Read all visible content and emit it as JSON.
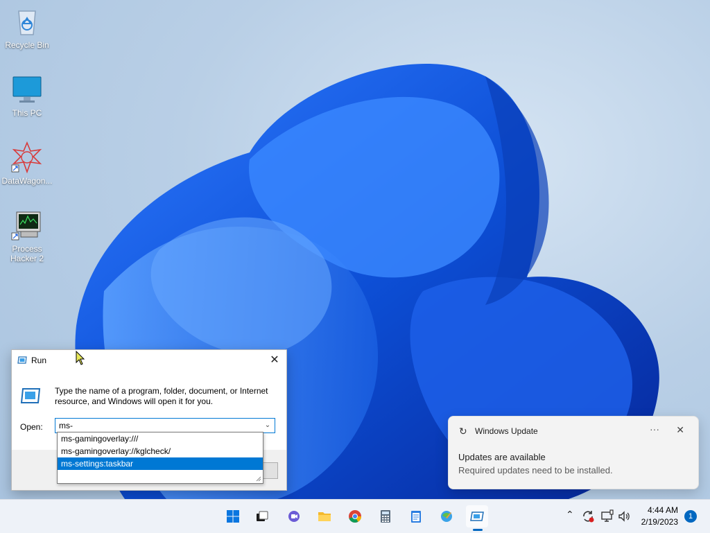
{
  "desktop": {
    "icons": [
      {
        "label": "Recycle Bin"
      },
      {
        "label": "This PC"
      },
      {
        "label": "DataWagon..."
      },
      {
        "label": "Process Hacker 2"
      }
    ]
  },
  "run_dialog": {
    "title": "Run",
    "close": "✕",
    "description": "Type the name of a program, folder, document, or Internet resource, and Windows will open it for you.",
    "open_label": "Open:",
    "open_value": "ms-",
    "autocomplete": [
      {
        "text": "ms-gamingoverlay:///",
        "selected": false
      },
      {
        "text": "ms-gamingoverlay://kglcheck/",
        "selected": false
      },
      {
        "text": "ms-settings:taskbar",
        "selected": true
      }
    ]
  },
  "toast": {
    "app": "Windows Update",
    "more": "···",
    "close": "✕",
    "heading": "Updates are available",
    "body": "Required updates need to be installed."
  },
  "taskbar": {
    "clock_time": "4:44 AM",
    "clock_date": "2/19/2023",
    "notification_count": "1",
    "colors": {
      "accent": "#0067c0",
      "selection": "#0078d4"
    }
  }
}
